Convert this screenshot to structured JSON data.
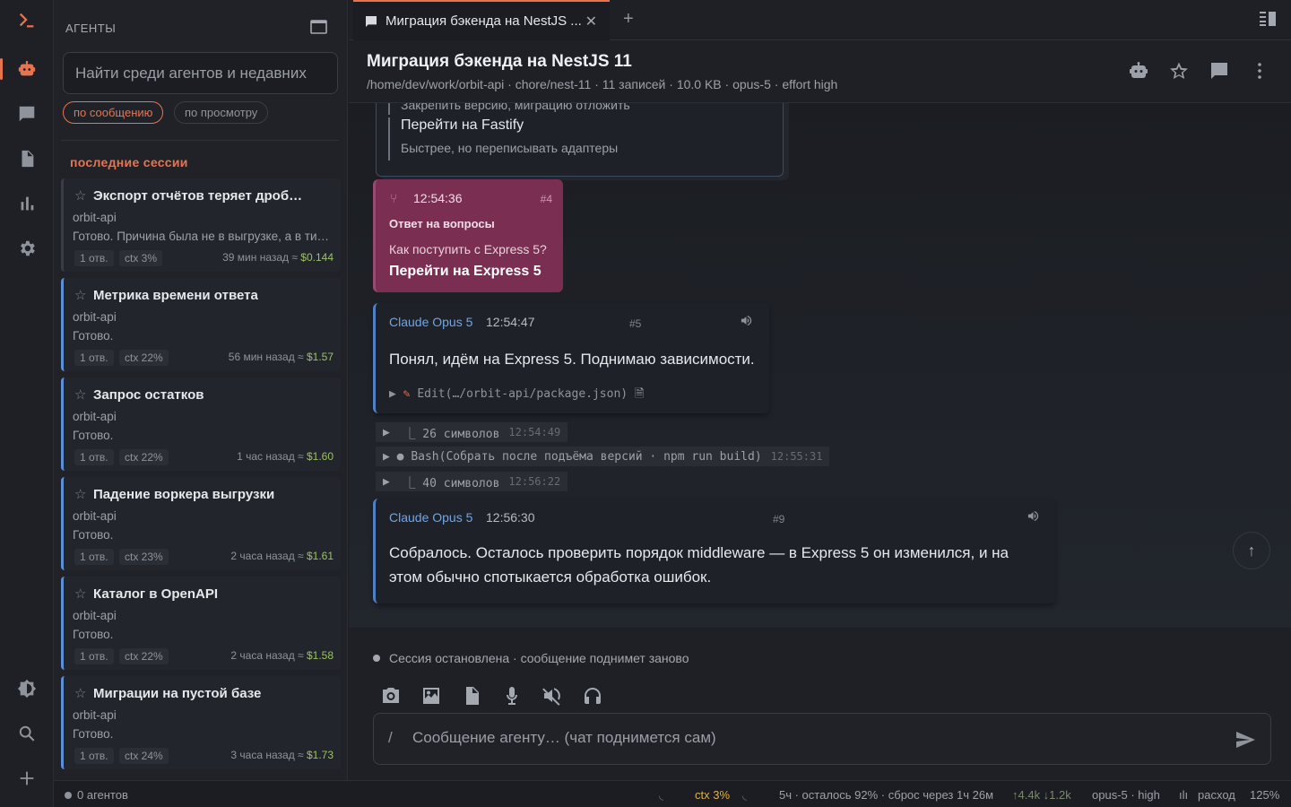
{
  "sidebar": {
    "heading": "АГЕНТЫ",
    "search_placeholder": "Найти среди агентов и недавних",
    "filters": [
      "по сообщению",
      "по просмотру"
    ],
    "recent_heading": "последние сессии",
    "sessions": [
      {
        "title": "Экспорт отчётов теряет дроб…",
        "project": "orbit-api",
        "preview": "Готово. Причина была не в выгрузке, а в ти…",
        "replies": "1 отв.",
        "ctx": "ctx 3%",
        "ago": "39 мин назад ≈ ",
        "cost": "$0.144"
      },
      {
        "title": "Метрика времени ответа",
        "project": "orbit-api",
        "preview": "Готово.",
        "replies": "1 отв.",
        "ctx": "ctx 22%",
        "ago": "56 мин назад ≈ ",
        "cost": "$1.57"
      },
      {
        "title": "Запрос остатков",
        "project": "orbit-api",
        "preview": "Готово.",
        "replies": "1 отв.",
        "ctx": "ctx 22%",
        "ago": "1 час назад ≈ ",
        "cost": "$1.60"
      },
      {
        "title": "Падение воркера выгрузки",
        "project": "orbit-api",
        "preview": "Готово.",
        "replies": "1 отв.",
        "ctx": "ctx 23%",
        "ago": "2 часа назад ≈ ",
        "cost": "$1.61"
      },
      {
        "title": "Каталог в OpenAPI",
        "project": "orbit-api",
        "preview": "Готово.",
        "replies": "1 отв.",
        "ctx": "ctx 22%",
        "ago": "2 часа назад ≈ ",
        "cost": "$1.58"
      },
      {
        "title": "Миграции на пустой базе",
        "project": "orbit-api",
        "preview": "Готово.",
        "replies": "1 отв.",
        "ctx": "ctx 24%",
        "ago": "3 часа назад ≈ ",
        "cost": "$1.73"
      }
    ]
  },
  "tab": {
    "label": "Миграция бэкенда на NestJS ...",
    "close": "✕",
    "add": "+"
  },
  "header": {
    "title": "Миграция бэкенда на NestJS 11",
    "subtitle": "/home/dev/work/orbit-api · chore/nest-11 · 11 записей · 10.0 KB · opus-5 · effort high"
  },
  "messages": {
    "prev_options": [
      {
        "title": "",
        "desc": "Закрепить версию, миграцию отложить"
      },
      {
        "title": "Перейти на Fastify",
        "desc": "Быстрее, но переписывать адаптеры"
      }
    ],
    "user": {
      "icon": "⑂",
      "time": "12:54:36",
      "num": "#4",
      "label": "Ответ на вопросы",
      "question": "Как поступить с Express 5?",
      "answer": "Перейти на Express 5"
    },
    "bot1": {
      "author": "Claude Opus 5",
      "time": "12:54:47",
      "num": "#5",
      "text": "Понял, идём на Express 5. Поднимаю зависимости.",
      "edit_label": "Edit",
      "edit_path": "(…/orbit-api/package.json)"
    },
    "tool1": {
      "text": "⎿  26 символов",
      "time": "12:54:49"
    },
    "tool2": {
      "text": "Bash(Собрать после подъёма версий · npm run build)",
      "time": "12:55:31"
    },
    "tool3": {
      "text": "⎿  40 символов",
      "time": "12:56:22"
    },
    "bot2": {
      "author": "Claude Opus 5",
      "time": "12:56:30",
      "num": "#9",
      "text": "Собралось. Осталось проверить порядок middleware — в Express 5 он изменился, и на этом обычно спотыкается обработка ошибок."
    }
  },
  "composer": {
    "status": "Сессия остановлена · сообщение поднимет заново",
    "slash": "/",
    "placeholder": "Сообщение агенту… (чат поднимется сам)"
  },
  "statusbar": {
    "agents": "0 агентов",
    "ctx": "ctx 3%",
    "limits": "5ч · осталось 92% · сброс через 1ч 26м",
    "io": "↑4.4k ↓1.2k",
    "model": "opus-5 · high",
    "spend": "расход",
    "zoom": "125%"
  },
  "colors": {
    "accent": "#e8744f",
    "user_bubble": "#7a2f52",
    "bot_accent": "#4f7fc4",
    "cost": "#9bc264"
  }
}
